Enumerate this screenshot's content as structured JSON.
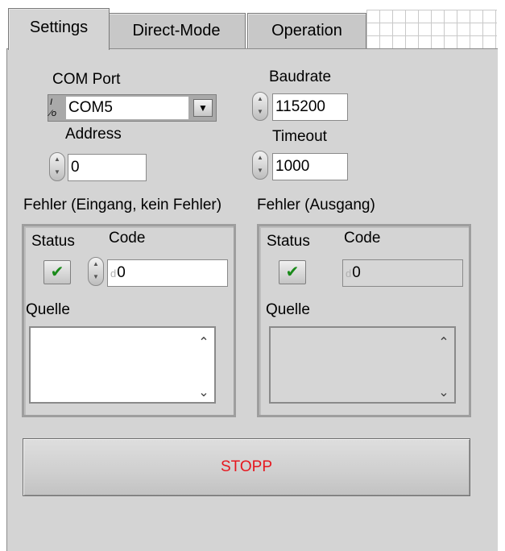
{
  "tabs": [
    {
      "label": "Settings",
      "active": true
    },
    {
      "label": "Direct-Mode",
      "active": false
    },
    {
      "label": "Operation",
      "active": false
    }
  ],
  "settings": {
    "com_port": {
      "label": "COM Port",
      "value": "COM5",
      "io_glyph": "I/O"
    },
    "baudrate": {
      "label": "Baudrate",
      "value": "115200"
    },
    "address": {
      "label": "Address",
      "value": "0"
    },
    "timeout": {
      "label": "Timeout",
      "value": "1000"
    }
  },
  "error_in": {
    "label": "Fehler (Eingang, kein Fehler)",
    "status_label": "Status",
    "code_label": "Code",
    "code_value": "0",
    "source_label": "Quelle",
    "source_value": ""
  },
  "error_out": {
    "label": "Fehler (Ausgang)",
    "status_label": "Status",
    "code_label": "Code",
    "code_value": "0",
    "source_label": "Quelle",
    "source_value": ""
  },
  "radix": "d",
  "check_glyph": "✔",
  "stop_button": {
    "label": "STOPP",
    "color": "#e6161e"
  }
}
